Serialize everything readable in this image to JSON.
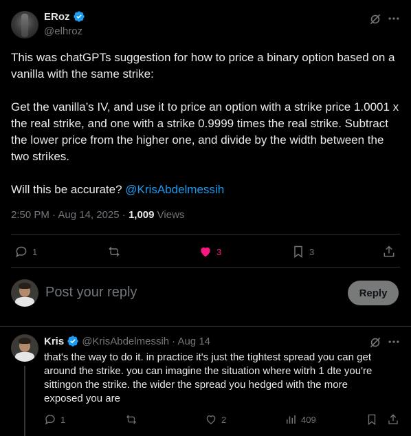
{
  "tweet": {
    "author_name": "ERoz",
    "author_handle": "@elhroz",
    "body": "This was chatGPTs suggestion for how to price a binary option based on a vanilla with the same strike:\n\nGet the vanilla’s IV, and use it to price an option with a strike price 1.0001 x the real strike, and one with a strike 0.9999 times the real strike. Subtract the lower price from the higher one, and divide by the width between the two strikes.\n\nWill this be accurate? ",
    "mention": "@KrisAbdelmessih",
    "timestamp": "2:50 PM · Aug 14, 2025 · ",
    "views_count": "1,009",
    "views_label": " Views",
    "replies": "1",
    "reposts": "",
    "likes": "3",
    "bookmarks": "3"
  },
  "compose": {
    "placeholder": "Post your reply",
    "reply_button": "Reply"
  },
  "reply": {
    "author_name": "Kris",
    "author_handle": "@KrisAbdelmessih",
    "date": " · Aug 14",
    "body": "that's the way to do it. in practice it's just the tightest spread you can get around the strike. you can imagine the situation where witrh 1 dte you're sittingon the strike. the wider the spread you hedged with the more exposed you are",
    "replies": "1",
    "reposts": "",
    "likes": "2",
    "views": "409"
  },
  "colors": {
    "background": "#000000",
    "text": "#e7e9ea",
    "secondary": "#71767b",
    "accent": "#1d9bf0",
    "like": "#f91880",
    "divider": "#2f3336"
  }
}
